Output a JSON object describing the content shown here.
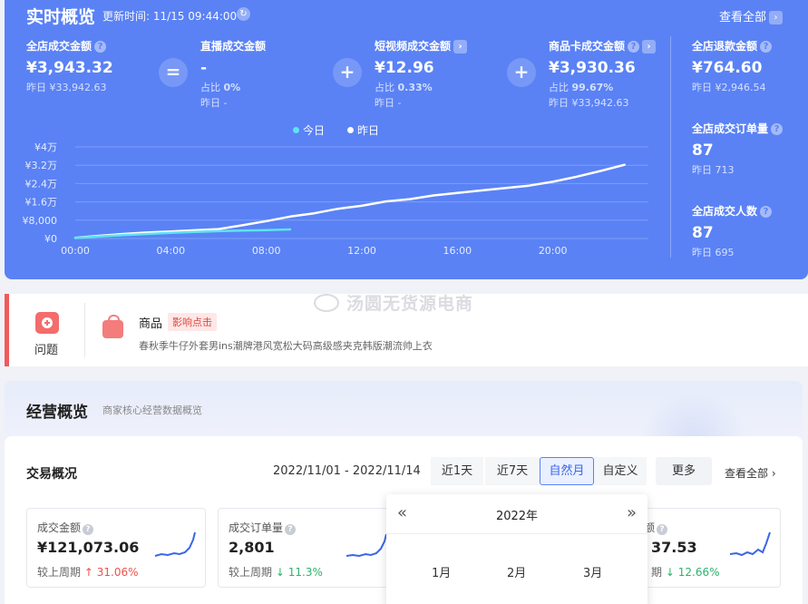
{
  "realtime": {
    "title": "实时概览",
    "update_time": "更新时间: 11/15 09:44:00",
    "refresh_icon": "refresh-icon",
    "view_all": "查看全部",
    "metrics": {
      "total_gmv": {
        "label": "全店成交金额",
        "value": "¥3,943.32",
        "yesterday": "昨日 ¥33,942.63"
      },
      "live_gmv": {
        "label": "直播成交金额",
        "value": "-",
        "ratio_label": "占比",
        "ratio": "0%",
        "yesterday": "昨日 -"
      },
      "video_gmv": {
        "label": "短视频成交金额",
        "value": "¥12.96",
        "ratio_label": "占比",
        "ratio": "0.33%",
        "yesterday": "昨日 -"
      },
      "card_gmv": {
        "label": "商品卡成交金额",
        "value": "¥3,930.36",
        "ratio_label": "占比",
        "ratio": "99.67%",
        "yesterday": "昨日 ¥33,942.63"
      },
      "refund": {
        "label": "全店退款金额",
        "value": "¥764.60",
        "yesterday": "昨日 ¥2,946.54"
      },
      "orders": {
        "label": "全店成交订单量",
        "value": "87",
        "yesterday": "昨日 713"
      },
      "buyers": {
        "label": "全店成交人数",
        "value": "87",
        "yesterday": "昨日 695"
      }
    },
    "ops": {
      "equals": "=",
      "plus": "+"
    },
    "legend": {
      "today": "今日",
      "yesterday": "昨日"
    },
    "colors": {
      "today": "#5ee3f0",
      "yesterday": "#ffffff",
      "panel": "#5a82f5"
    }
  },
  "chart_data": {
    "type": "line",
    "title": "",
    "xlabel": "",
    "ylabel": "",
    "y_ticks": [
      "¥0",
      "¥8,000",
      "¥1.6万",
      "¥2.4万",
      "¥3.2万",
      "¥4万"
    ],
    "x_ticks": [
      "00:00",
      "04:00",
      "08:00",
      "12:00",
      "16:00",
      "20:00"
    ],
    "ylim": [
      0,
      40000
    ],
    "xlim": [
      0,
      24
    ],
    "series": [
      {
        "name": "今日",
        "x": [
          0,
          1,
          2,
          3,
          4,
          5,
          6,
          7,
          8,
          9
        ],
        "values": [
          200,
          900,
          1500,
          2000,
          2500,
          2900,
          3200,
          3500,
          3700,
          3943
        ]
      },
      {
        "name": "昨日",
        "x": [
          0,
          1,
          2,
          3,
          4,
          5,
          6,
          7,
          8,
          9,
          10,
          11,
          12,
          13,
          14,
          15,
          16,
          17,
          18,
          19,
          20,
          21,
          22,
          23
        ],
        "values": [
          300,
          1200,
          2000,
          2600,
          3100,
          3600,
          4100,
          5800,
          7600,
          9600,
          11000,
          13000,
          14300,
          16200,
          17200,
          18800,
          19900,
          21000,
          22000,
          23100,
          24800,
          27000,
          29500,
          32200
        ]
      }
    ],
    "grid": true,
    "legend": "top-center"
  },
  "issue": {
    "kit_label": "问题",
    "product_label": "商品",
    "tag": "影响点击",
    "description": "春秋季牛仔外套男ins潮牌港风宽松大码高级感夹克韩版潮流帅上衣"
  },
  "watermark": "汤圆无货源电商",
  "business": {
    "title": "经营概览",
    "subtitle": "商家核心经营数据概览",
    "card_title": "交易概况",
    "date_range": "2022/11/01 - 2022/11/14",
    "tabs": [
      "近1天",
      "近7天",
      "自然月",
      "自定义"
    ],
    "active_tab": "自然月",
    "more": "更多",
    "view_all": "查看全部",
    "kpis": [
      {
        "label": "成交金额",
        "value": "¥121,073.06",
        "compare_label": "较上周期",
        "trend": "↑",
        "change": "31.06%",
        "dir": "up"
      },
      {
        "label": "成交订单量",
        "value": "2,801",
        "compare_label": "较上周期",
        "trend": "↓",
        "change": "11.3%",
        "dir": "down"
      },
      {
        "label": "额",
        "value": "37.53",
        "compare_label": "期",
        "trend": "↓",
        "change": "12.66%",
        "dir": "down"
      }
    ]
  },
  "picker": {
    "year": "2022年",
    "prev": "«",
    "next": "»",
    "months": [
      "1月",
      "2月",
      "3月"
    ]
  }
}
